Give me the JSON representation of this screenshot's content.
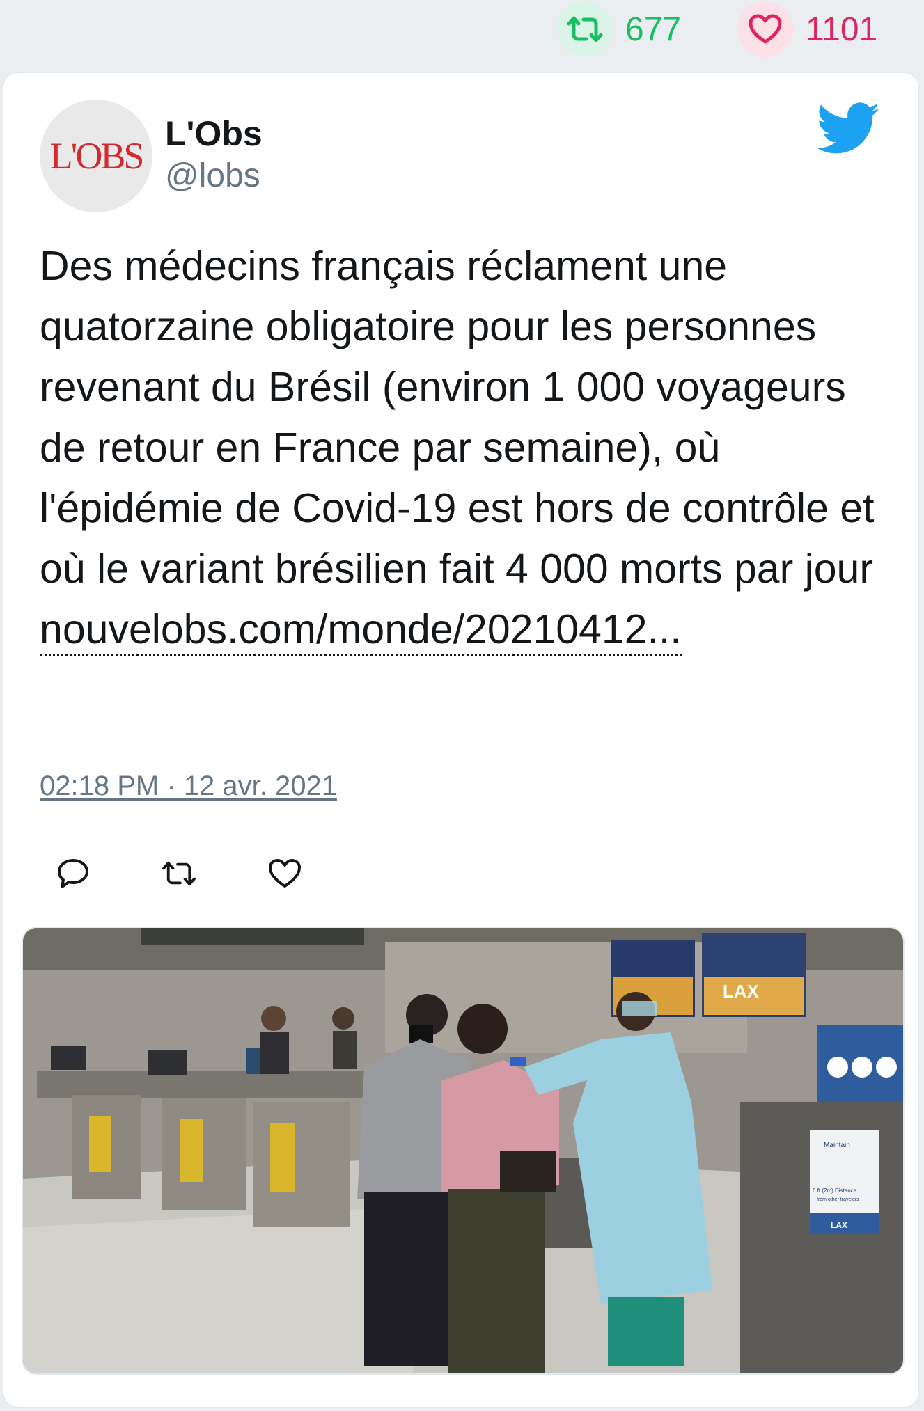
{
  "stats": {
    "retweets": "677",
    "likes": "1101",
    "retweet_icon": "retweet-icon",
    "like_icon": "heart-icon"
  },
  "tweet": {
    "author": {
      "name": "L'Obs",
      "handle": "@lobs",
      "avatar_logo": "L'OBS"
    },
    "text": "Des médecins français réclament une quatorzaine obligatoire pour les personnes revenant du Brésil (environ 1 000 voyageurs de retour en France par semaine), où l'épidémie de Covid-19 est hors de contrôle et où le variant brésilien fait 4 000 morts par jour",
    "link": "nouvelobs.com/monde/20210412...",
    "timestamp": "02:18 PM · 12 avr. 2021",
    "media": {
      "screen_sign": "LAX",
      "poster_heading": "Maintain",
      "poster_line1": "6 ft (2m) Distance",
      "poster_line2": "from other travelers",
      "poster_footer": "LAX"
    }
  },
  "colors": {
    "retweet_green": "#17bf63",
    "like_red": "#e0245e",
    "twitter_blue": "#1da1f2",
    "muted_gray": "#657786"
  }
}
